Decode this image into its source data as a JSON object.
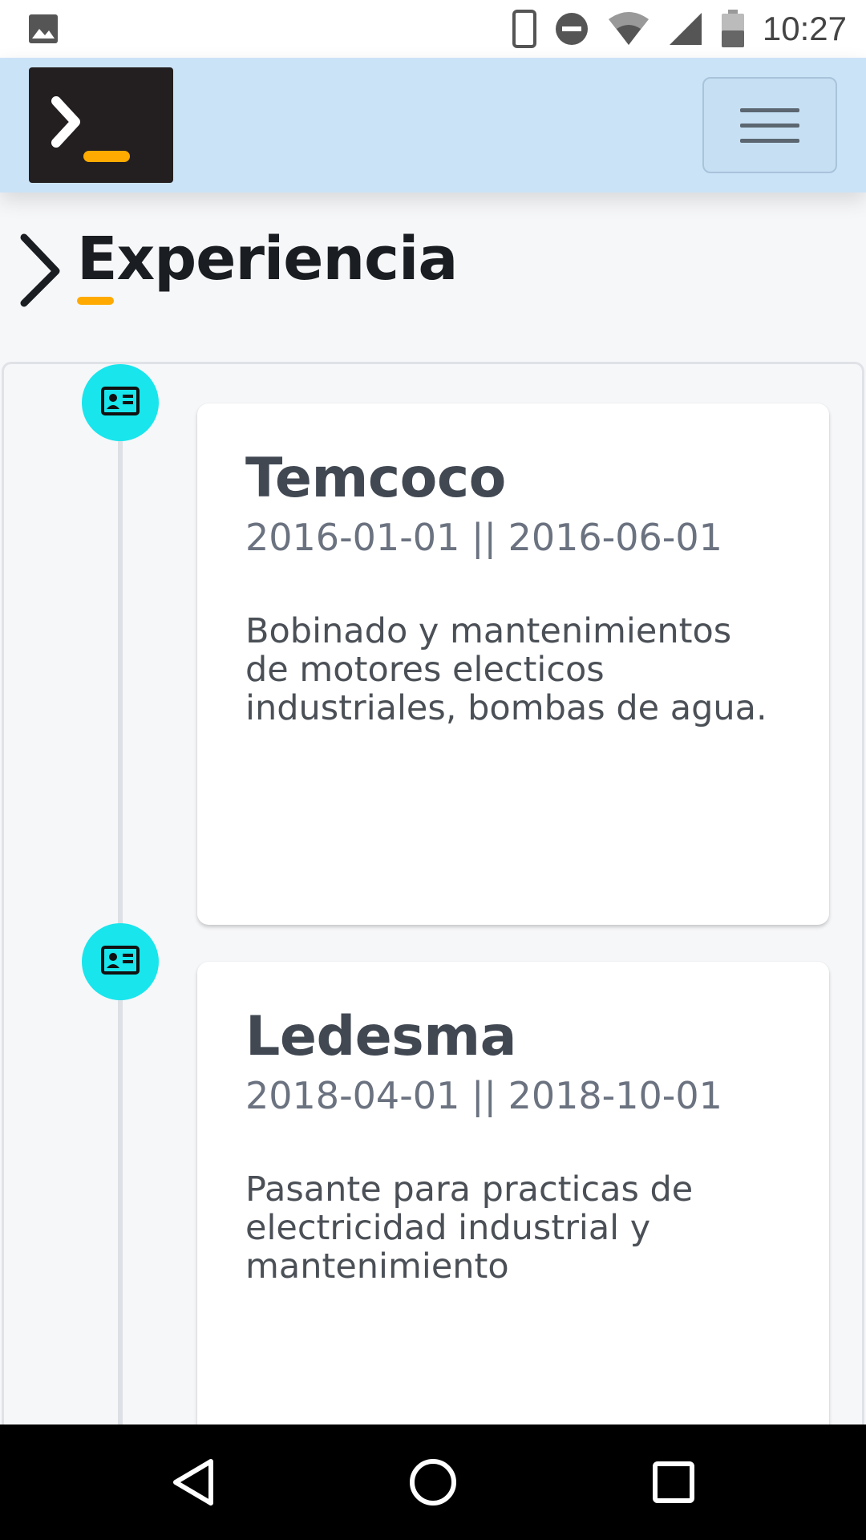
{
  "status_bar": {
    "time": "10:27",
    "battery_level": "47",
    "icons": [
      "image-icon",
      "phone-icon",
      "dnd-icon",
      "wifi-icon",
      "signal-icon",
      "battery-icon"
    ]
  },
  "navbar": {
    "logo_icon": "terminal-logo-icon",
    "menu_icon": "hamburger-icon",
    "colors": {
      "background": "#cbe3f7",
      "logo_bg": "#231f20",
      "logo_accent": "#ffaa00"
    }
  },
  "section": {
    "title": "Experiencia",
    "colors": {
      "underline": "#ffaa00"
    }
  },
  "timeline": {
    "node_icon": "id-card-icon",
    "colors": {
      "node": "#19e5ec"
    },
    "items": [
      {
        "company": "Temcoco",
        "dates": "2016-01-01 || 2016-06-01",
        "description": "Bobinado y mantenimientos de motores electicos industriales, bombas de agua."
      },
      {
        "company": "Ledesma",
        "dates": "2018-04-01 || 2018-10-01",
        "description": "Pasante para practicas de electricidad industrial y mantenimiento"
      }
    ]
  },
  "nav_bar": {
    "icons": [
      "back-icon",
      "home-icon",
      "recents-icon"
    ]
  }
}
